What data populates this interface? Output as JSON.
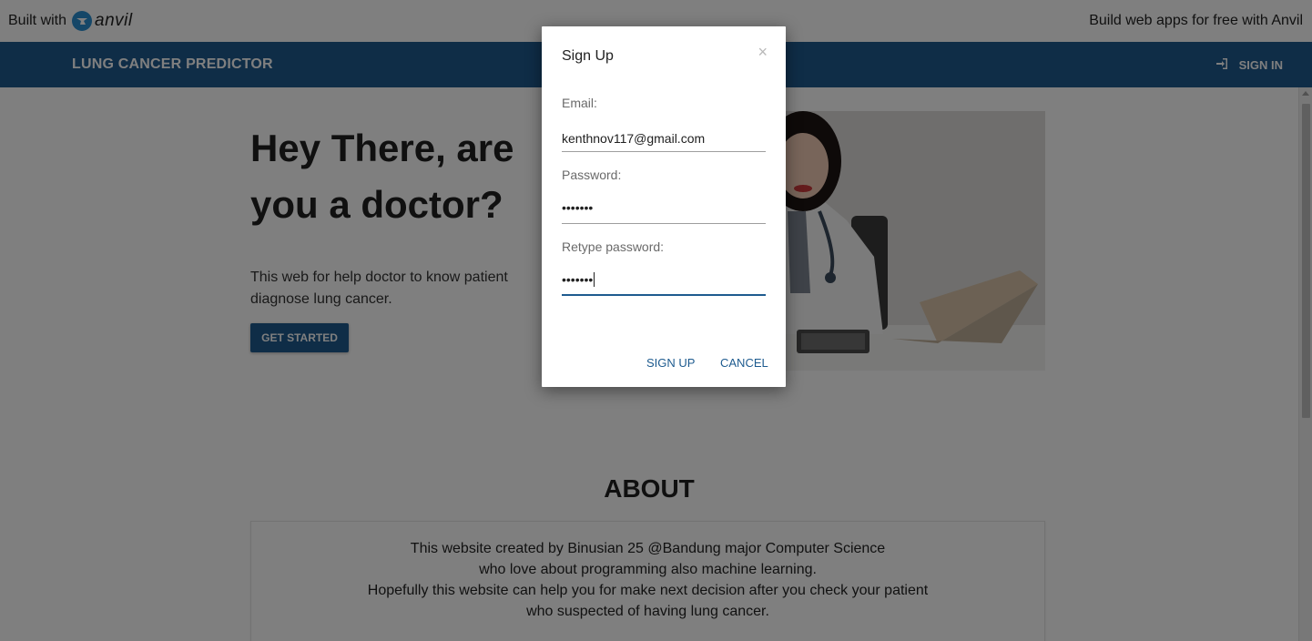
{
  "builtbar": {
    "prefix": "Built with",
    "logo_text": "anvil",
    "right_text": "Build web apps for free with Anvil"
  },
  "nav": {
    "brand": "LUNG CANCER PREDICTOR",
    "signin_label": "SIGN IN",
    "signin_icon": "sign-in-icon"
  },
  "hero": {
    "title": "Hey There, are you a doctor?",
    "text": "This web for help doctor to know patient diagnose lung cancer.",
    "cta_label": "GET STARTED"
  },
  "about": {
    "title": "ABOUT",
    "lines": [
      "This website created by Binusian 25 @Bandung major Computer Science",
      "who love about programming also machine learning.",
      "Hopefully this website can help you for make next decision after you check your patient",
      "who suspected of having lung cancer."
    ]
  },
  "modal": {
    "title": "Sign Up",
    "close_glyph": "×",
    "email_label": "Email:",
    "email_value": "kenthnov117@gmail.com",
    "password_label": "Password:",
    "password_value": "•••••••",
    "retype_label": "Retype password:",
    "retype_value": "•••••••",
    "signup_label": "SIGN UP",
    "cancel_label": "CANCEL"
  },
  "colors": {
    "primary": "#1e5b8f",
    "overlay": "rgba(0,0,0,0.5)"
  }
}
